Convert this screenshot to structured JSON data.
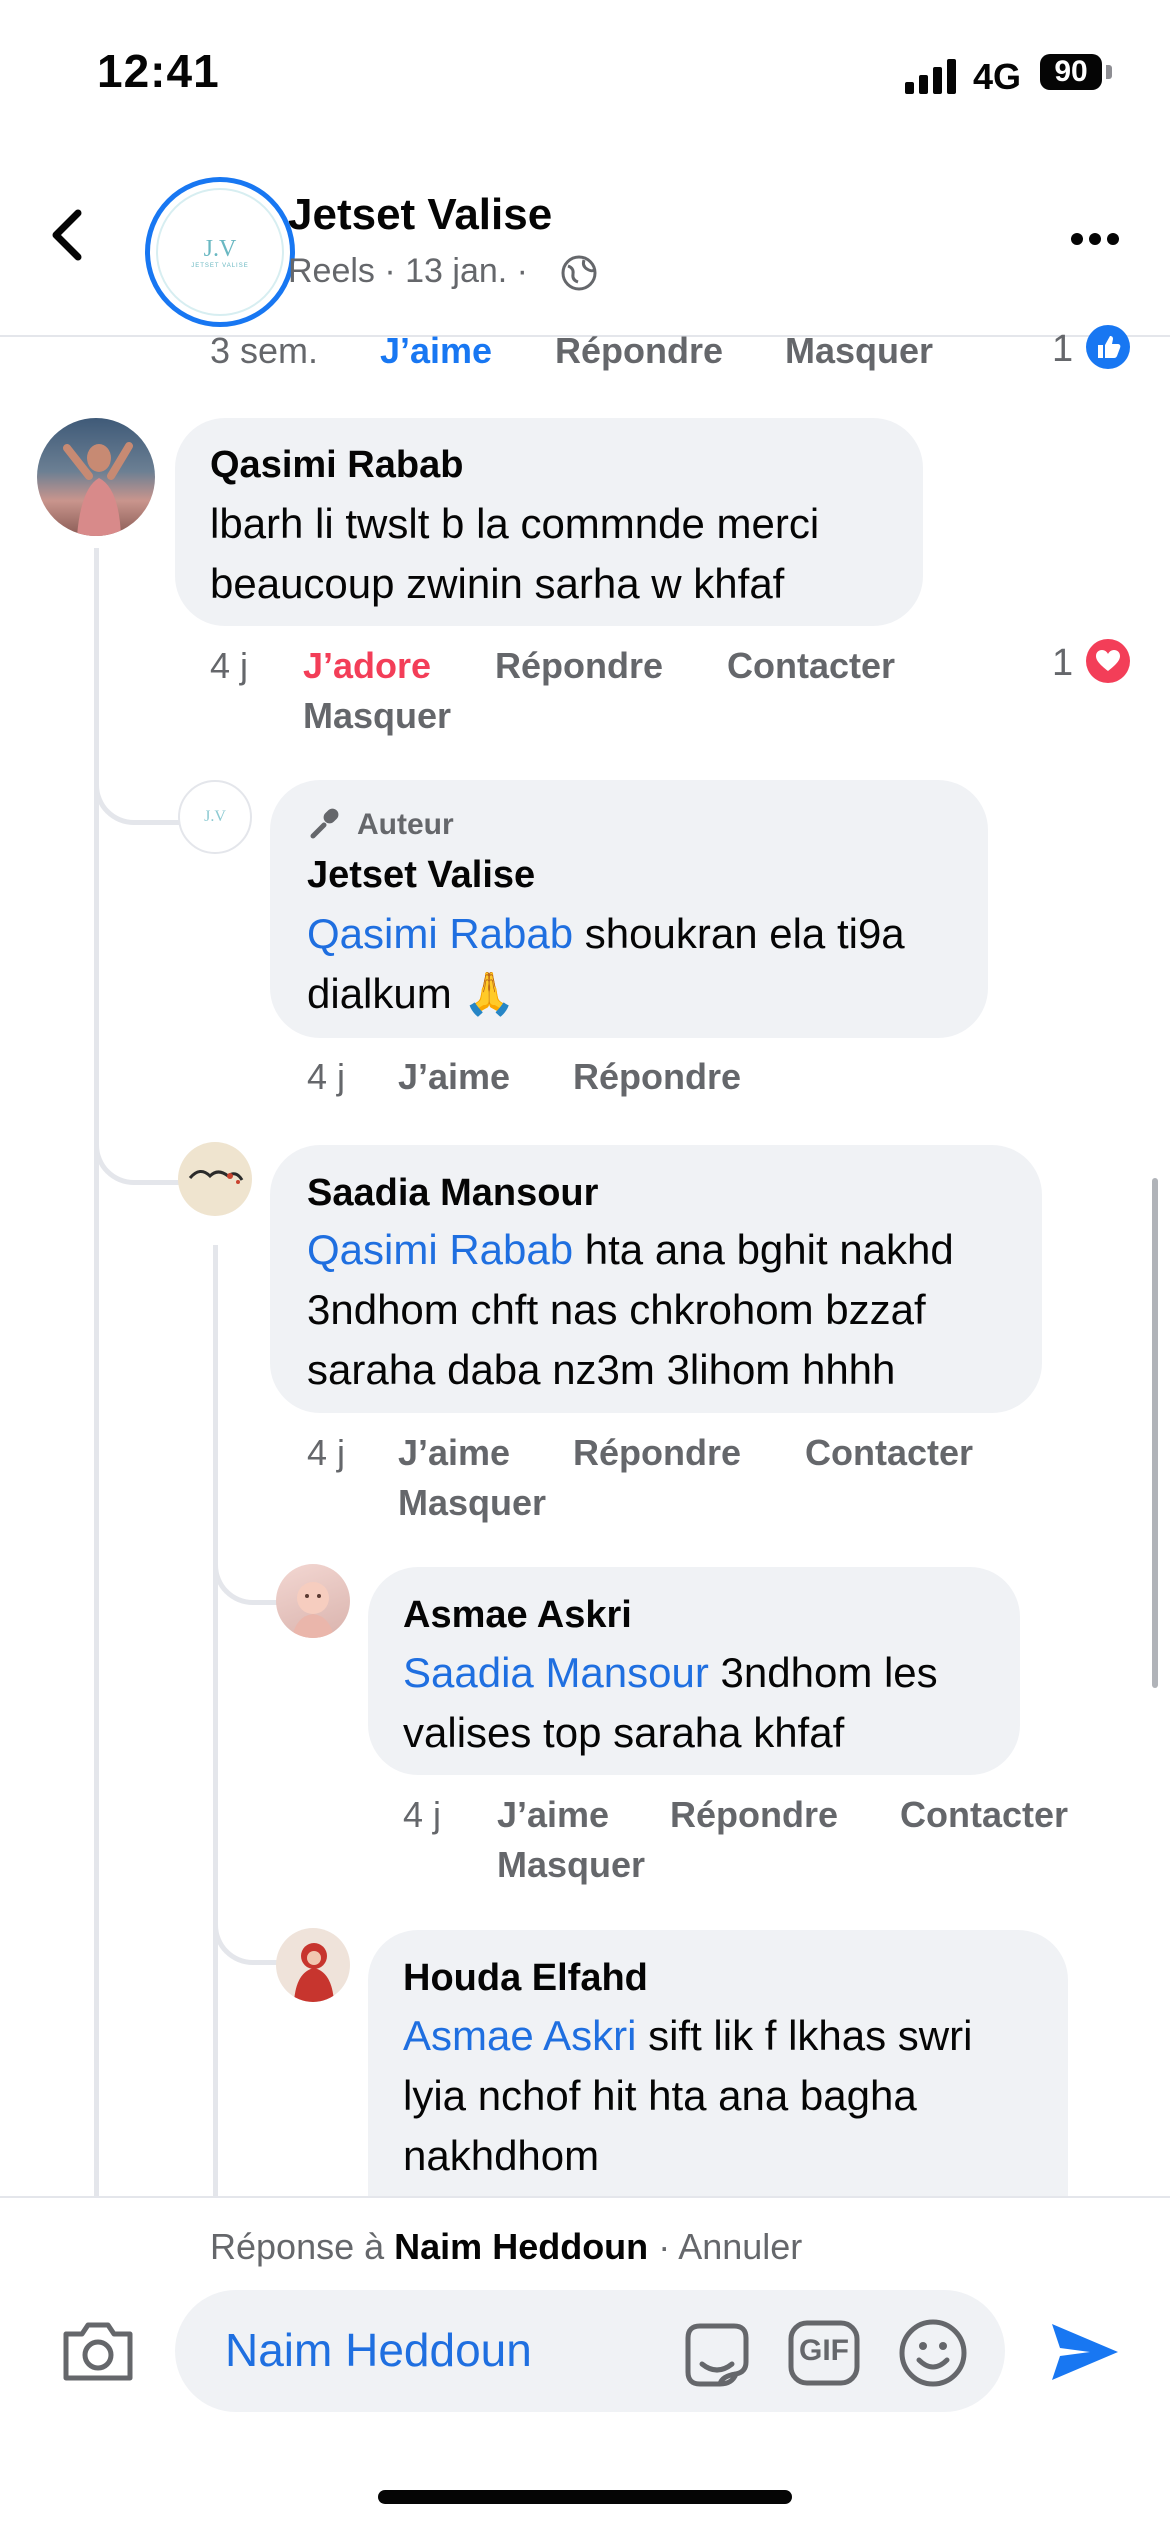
{
  "status": {
    "time": "12:41",
    "network": "4G",
    "battery": "90"
  },
  "header": {
    "title": "Jetset Valise",
    "subtitle": "Reels · 13 jan. ·",
    "avatar_monogram": "J.V",
    "avatar_tagline": "JETSET VALISE"
  },
  "prev_meta": {
    "time": "3 sem.",
    "like": "J’aime",
    "reply": "Répondre",
    "hide": "Masquer",
    "count": "1"
  },
  "comments": [
    {
      "name": "Qasimi Rabab",
      "line1": "lbarh li twslt b la commnde merci",
      "line2": "beaucoup zwinin sarha w khfaf",
      "time": "4 j",
      "react": "J’adore",
      "reply": "Répondre",
      "contact": "Contacter",
      "hide": "Masquer",
      "count": "1"
    },
    {
      "badge": "Auteur",
      "name": "Jetset Valise",
      "mention": "Qasimi Rabab",
      "line1": " shoukran ela ti9a",
      "line2": "dialkum 🙏",
      "time": "4 j",
      "like": "J’aime",
      "reply": "Répondre"
    },
    {
      "name": "Saadia Mansour",
      "mention": "Qasimi Rabab",
      "line1": " hta ana bghit nakhd",
      "line2": "3ndhom chft nas chkrohom bzzaf",
      "line3": "saraha daba nz3m 3lihom hhhh",
      "time": "4 j",
      "like": "J’aime",
      "reply": "Répondre",
      "contact": "Contacter",
      "hide": "Masquer"
    },
    {
      "name": "Asmae Askri",
      "mention": "Saadia Mansour",
      "line1": " 3ndhom les",
      "line2": "valises top saraha khfaf",
      "time": "4 j",
      "like": "J’aime",
      "reply": "Répondre",
      "contact": "Contacter",
      "hide": "Masquer"
    },
    {
      "name": "Houda Elfahd",
      "mention": "Asmae Askri",
      "line1": " sift lik f lkhas swri",
      "line2": "lyia nchof hit hta ana bagha",
      "line3": "nakhdhom"
    }
  ],
  "composer": {
    "reply_prefix": "Réponse à",
    "reply_name": "Naim Heddoun",
    "cancel": "· Annuler",
    "input_value": "Naim Heddoun",
    "gif_label": "GIF"
  },
  "colors": {
    "accent": "#1877f2",
    "mention": "#1f6fe0",
    "love": "#f33e58",
    "bubble": "#f0f2f5",
    "meta": "#65676b"
  }
}
